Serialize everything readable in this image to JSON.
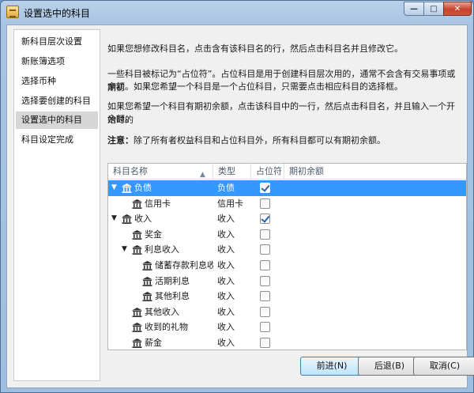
{
  "window": {
    "title": "设置选中的科目"
  },
  "sidebar": {
    "items": [
      {
        "label": "新科目层次设置"
      },
      {
        "label": "新账簿选项"
      },
      {
        "label": "选择币种"
      },
      {
        "label": "选择要创建的科目"
      },
      {
        "label": "设置选中的科目",
        "active": true
      },
      {
        "label": "科目设定完成"
      }
    ]
  },
  "main": {
    "para1": "如果您想修改科目名，点击含有该科目名的行，然后点击科目名并且修改它。",
    "para2_line1": "一些科目被标记为“占位符”。占位科目是用于创建科目层次用的，通常不会含有交易事项或期初",
    "para2_line2": "余额。如果您希望一个科目是一个占位科目，只需要点击相应科目的选择框。",
    "para3_line1": "如果您希望一个科目有期初余额，点击该科目中的一行，然后点击科目名，并且输入一个开始时的",
    "para3_line2": "余额。",
    "note_label": "注意：",
    "note_text": "除了所有者权益科目和占位科目外，所有科目都可以有期初余额。"
  },
  "table": {
    "columns": [
      "科目名称",
      "类型",
      "占位符",
      "期初余额"
    ],
    "rows": [
      {
        "name": "负债",
        "type": "负债",
        "placeholder": true,
        "level": 0,
        "expander": "expanded",
        "selected": true
      },
      {
        "name": "信用卡",
        "type": "信用卡",
        "placeholder": false,
        "level": 1,
        "expander": "none"
      },
      {
        "name": "收入",
        "type": "收入",
        "placeholder": true,
        "level": 0,
        "expander": "expanded"
      },
      {
        "name": "奖金",
        "type": "收入",
        "placeholder": false,
        "level": 1,
        "expander": "none"
      },
      {
        "name": "利息收入",
        "type": "收入",
        "placeholder": false,
        "level": 1,
        "expander": "expanded"
      },
      {
        "name": "储蓄存款利息收",
        "type": "收入",
        "placeholder": false,
        "level": 2,
        "expander": "none"
      },
      {
        "name": "活期利息",
        "type": "收入",
        "placeholder": false,
        "level": 2,
        "expander": "none"
      },
      {
        "name": "其他利息",
        "type": "收入",
        "placeholder": false,
        "level": 2,
        "expander": "none"
      },
      {
        "name": "其他收入",
        "type": "收入",
        "placeholder": false,
        "level": 1,
        "expander": "none"
      },
      {
        "name": "收到的礼物",
        "type": "收入",
        "placeholder": false,
        "level": 1,
        "expander": "none"
      },
      {
        "name": "薪金",
        "type": "收入",
        "placeholder": false,
        "level": 1,
        "expander": "none"
      }
    ]
  },
  "buttons": {
    "forward": "前进(N)",
    "back": "后退(B)",
    "cancel": "取消(C)"
  },
  "icons": {
    "expanded": "triangle-down-icon",
    "account": "bank-icon"
  },
  "colors": {
    "selection": "#3399ff",
    "check": "#2a63b3"
  }
}
